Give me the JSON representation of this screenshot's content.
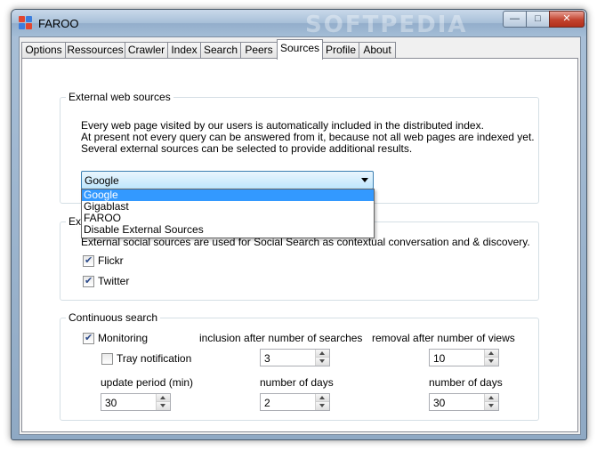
{
  "window": {
    "title": "FAROO",
    "watermark": "SOFTPEDIA",
    "buttons": {
      "minimize": "—",
      "maximize": "□",
      "close": "✕"
    }
  },
  "tabs": [
    {
      "label": "Options"
    },
    {
      "label": "Ressources"
    },
    {
      "label": "Crawler"
    },
    {
      "label": "Index"
    },
    {
      "label": "Search"
    },
    {
      "label": "Peers"
    },
    {
      "label": "Sources",
      "active": true
    },
    {
      "label": "Profile"
    },
    {
      "label": "About"
    }
  ],
  "external_web": {
    "title": "External web sources",
    "description": [
      "Every web page visited by our users is automatically included in the distributed index.",
      "At present not every query can be answered from it, because not all web pages are indexed yet.",
      "Several external sources can be selected to provide additional results."
    ],
    "selected": "Google",
    "options": [
      "Google",
      "Gigablast",
      "FAROO",
      "Disable External Sources"
    ]
  },
  "external_social": {
    "title": "Exte",
    "description": "External social sources are used for Social Search as contextual conversation and & discovery.",
    "flickr_label": "Flickr",
    "flickr_checked": true,
    "twitter_label": "Twitter",
    "twitter_checked": true
  },
  "continuous": {
    "title": "Continuous search",
    "monitoring_label": "Monitoring",
    "monitoring_checked": true,
    "tray_label": "Tray notification",
    "tray_checked": false,
    "inclusion_label": "inclusion after number of searches",
    "inclusion_value": "3",
    "removal_label": "removal after number of views",
    "removal_value": "10",
    "update_label": "update period (min)",
    "update_value": "30",
    "days1_label": "number of days",
    "days1_value": "2",
    "days2_label": "number of days",
    "days2_value": "30"
  },
  "colors": {
    "selection": "#3399ff",
    "close_button": "#c2432e",
    "titlebar": "#a7bfd8"
  }
}
